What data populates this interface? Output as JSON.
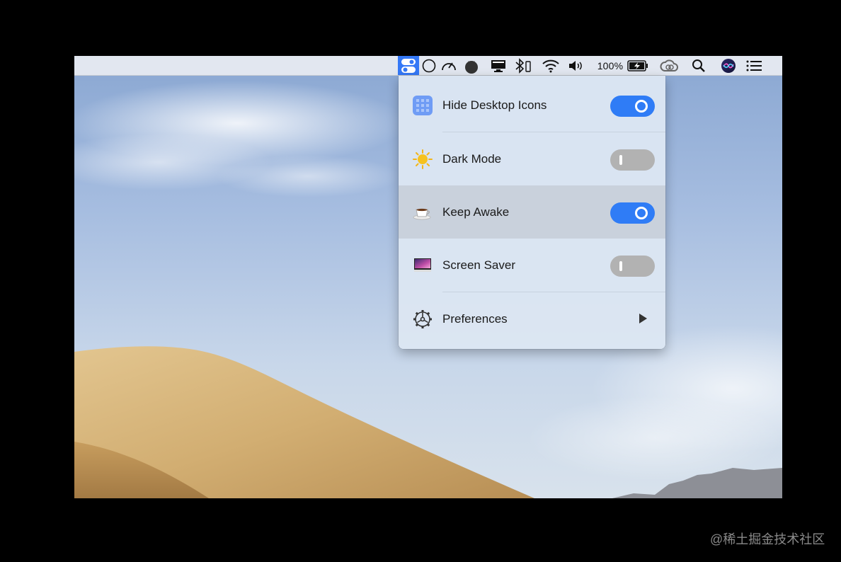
{
  "menubar": {
    "battery_percent": "100%",
    "icons": [
      "one-switch-icon",
      "circle-icon",
      "speedometer-icon",
      "tomato-icon",
      "display-icon",
      "bluetooth-icon",
      "wifi-icon",
      "volume-icon",
      "battery-icon",
      "creative-cloud-icon",
      "spotlight-icon",
      "siri-icon",
      "notification-center-icon"
    ]
  },
  "menu": {
    "items": [
      {
        "label": "Hide Desktop Icons",
        "icon": "grid-icon",
        "state": "on"
      },
      {
        "label": "Dark Mode",
        "icon": "sun-icon",
        "state": "off"
      },
      {
        "label": "Keep Awake",
        "icon": "coffee-icon",
        "state": "on",
        "highlighted": true
      },
      {
        "label": "Screen Saver",
        "icon": "monitor-icon",
        "state": "off"
      },
      {
        "label": "Preferences",
        "icon": "gear-icon",
        "submenu": true
      }
    ]
  },
  "watermark": "@稀土掘金技术社区",
  "colors": {
    "accent": "#2f7cf6",
    "toggle_off": "#b2b2b2",
    "menu_bg": "#dce6f3"
  }
}
